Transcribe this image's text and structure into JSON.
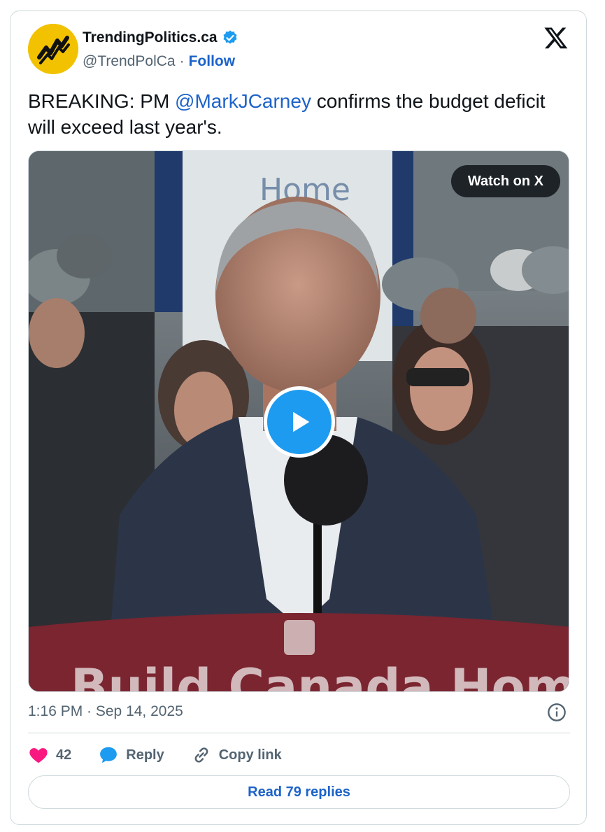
{
  "author": {
    "name": "TrendingPolitics.ca",
    "handle": "@TrendPolCa",
    "separator": "·",
    "follow_label": "Follow"
  },
  "tweet": {
    "text_prefix": "BREAKING: PM ",
    "mention": "@MarkJCarney",
    "text_suffix": " confirms the budget deficit will exceed last year's."
  },
  "media": {
    "watch_label": "Watch on X",
    "play_icon": "play-icon"
  },
  "meta": {
    "timestamp": "1:16 PM · Sep 14, 2025"
  },
  "actions": {
    "like_count": "42",
    "reply_label": "Reply",
    "copy_link_label": "Copy link"
  },
  "footer": {
    "read_replies_label": "Read 79 replies"
  },
  "colors": {
    "link": "#1d63c9",
    "secondary_text": "#536471",
    "like": "#f91880",
    "reply": "#1d9bf0",
    "avatar_bg": "#f2c200",
    "play_button": "#1d9bf0"
  }
}
